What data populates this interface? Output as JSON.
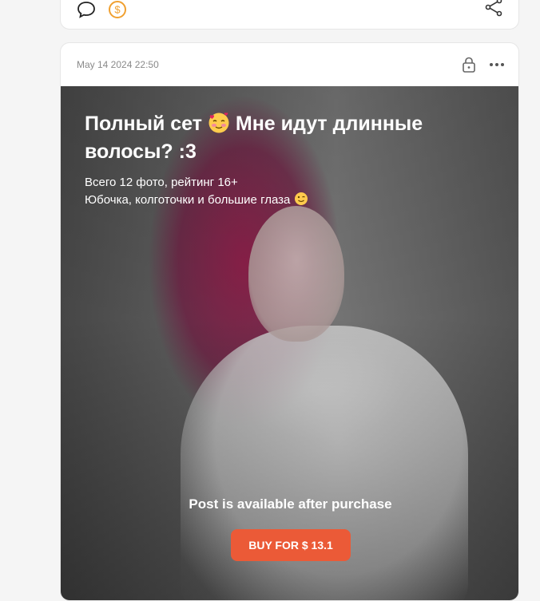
{
  "previous_post": {
    "icons": [
      "comment-icon",
      "coin-icon",
      "share-icon"
    ]
  },
  "post": {
    "date": "May 14 2024 22:50",
    "title_part1": "Полный сет ",
    "title_part2": " Мне идут длинные волосы? :3",
    "description_line1": "Всего 12 фото, рейтинг 16+",
    "description_line2": "Юбочка, колготочки и большие глаза ",
    "purchase_note": "Post is available after purchase",
    "buy_label": "BUY FOR $ 13.1",
    "accent_color": "#eb5a37",
    "icons": [
      "lock-icon",
      "more-icon",
      "blush-emoji-icon",
      "wink-emoji-icon"
    ]
  }
}
